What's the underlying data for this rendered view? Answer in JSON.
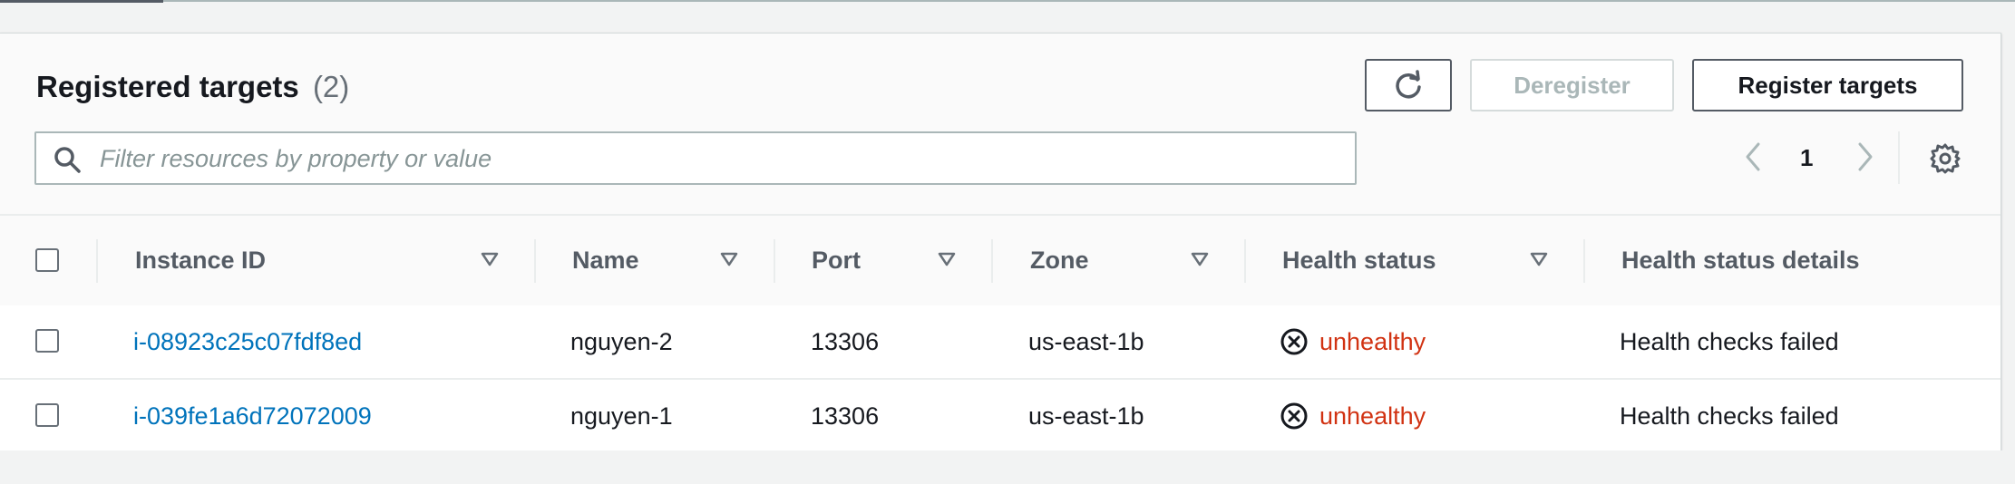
{
  "panel": {
    "title": "Registered targets",
    "count": "(2)",
    "buttons": {
      "refresh_icon": "refresh-icon",
      "deregister": "Deregister",
      "register": "Register targets"
    },
    "filter": {
      "placeholder": "Filter resources by property or value",
      "value": ""
    },
    "pagination": {
      "current_page": "1"
    }
  },
  "table": {
    "columns": [
      "Instance ID",
      "Name",
      "Port",
      "Zone",
      "Health status",
      "Health status details"
    ],
    "rows": [
      {
        "instance_id": "i-08923c25c07fdf8ed",
        "name": "nguyen-2",
        "port": "13306",
        "zone": "us-east-1b",
        "health_status": "unhealthy",
        "health_details": "Health checks failed"
      },
      {
        "instance_id": "i-039fe1a6d72072009",
        "name": "nguyen-1",
        "port": "13306",
        "zone": "us-east-1b",
        "health_status": "unhealthy",
        "health_details": "Health checks failed"
      }
    ]
  },
  "colors": {
    "link": "#0073bb",
    "unhealthy": "#d13212",
    "header_text": "#545b64",
    "disabled": "#aab7b8"
  }
}
